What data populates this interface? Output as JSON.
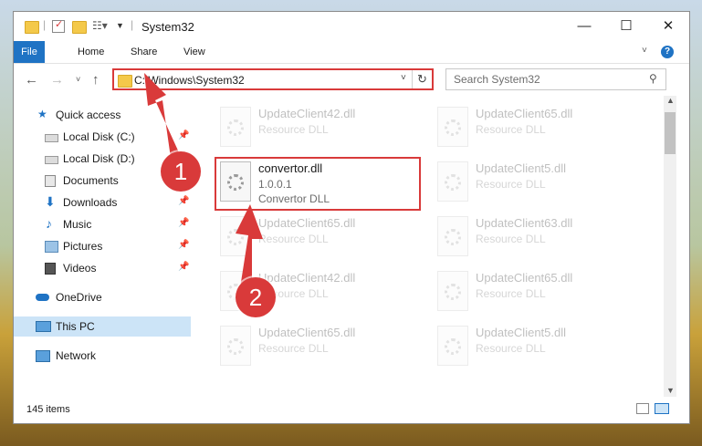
{
  "window": {
    "title": "System32",
    "minimize_glyph": "—",
    "maximize_glyph": "☐",
    "close_glyph": "✕"
  },
  "ribbon": {
    "tabs": [
      "File",
      "Home",
      "Share",
      "View"
    ],
    "help_glyph": "?"
  },
  "address": {
    "path": "C:\\Windows\\System32",
    "refresh_glyph": "↻"
  },
  "search": {
    "placeholder": "Search System32"
  },
  "sidebar": {
    "items": [
      {
        "label": "Quick access",
        "icon": "star-icon",
        "pinned": false
      },
      {
        "label": "Local Disk (C:)",
        "icon": "drive-icon",
        "pinned": true
      },
      {
        "label": "Local Disk (D:)",
        "icon": "drive-icon",
        "pinned": false
      },
      {
        "label": "Documents",
        "icon": "documents-icon",
        "pinned": true
      },
      {
        "label": "Downloads",
        "icon": "download-arrow-icon",
        "pinned": true
      },
      {
        "label": "Music",
        "icon": "music-note-icon",
        "pinned": true
      },
      {
        "label": "Pictures",
        "icon": "pictures-icon",
        "pinned": true
      },
      {
        "label": "Videos",
        "icon": "film-icon",
        "pinned": true
      },
      {
        "label": "OneDrive",
        "icon": "cloud-icon",
        "pinned": false
      },
      {
        "label": "This PC",
        "icon": "computer-icon",
        "pinned": false,
        "selected": true
      },
      {
        "label": "Network",
        "icon": "network-icon",
        "pinned": false
      }
    ]
  },
  "files": [
    {
      "name": "UpdateClient42.dll",
      "desc": "Resource DLL"
    },
    {
      "name": "UpdateClient65.dll",
      "desc": "Resource DLL"
    },
    {
      "name": "convertor.dll",
      "version": "1.0.0.1",
      "desc": "Convertor DLL"
    },
    {
      "name": "UpdateClient5.dll",
      "desc": "Resource DLL"
    },
    {
      "name": "UpdateClient65.dll",
      "desc": "Resource DLL"
    },
    {
      "name": "UpdateClient63.dll",
      "desc": "Resource DLL"
    },
    {
      "name": "UpdateClient42.dll",
      "desc": "Resource DLL"
    },
    {
      "name": "UpdateClient65.dll",
      "desc": "Resource DLL"
    },
    {
      "name": "UpdateClient65.dll",
      "desc": "Resource DLL"
    },
    {
      "name": "UpdateClient5.dll",
      "desc": "Resource DLL"
    }
  ],
  "status": {
    "item_count": "145 items"
  },
  "annotations": {
    "marker1": "1",
    "marker2": "2",
    "color": "#d93a3a"
  }
}
